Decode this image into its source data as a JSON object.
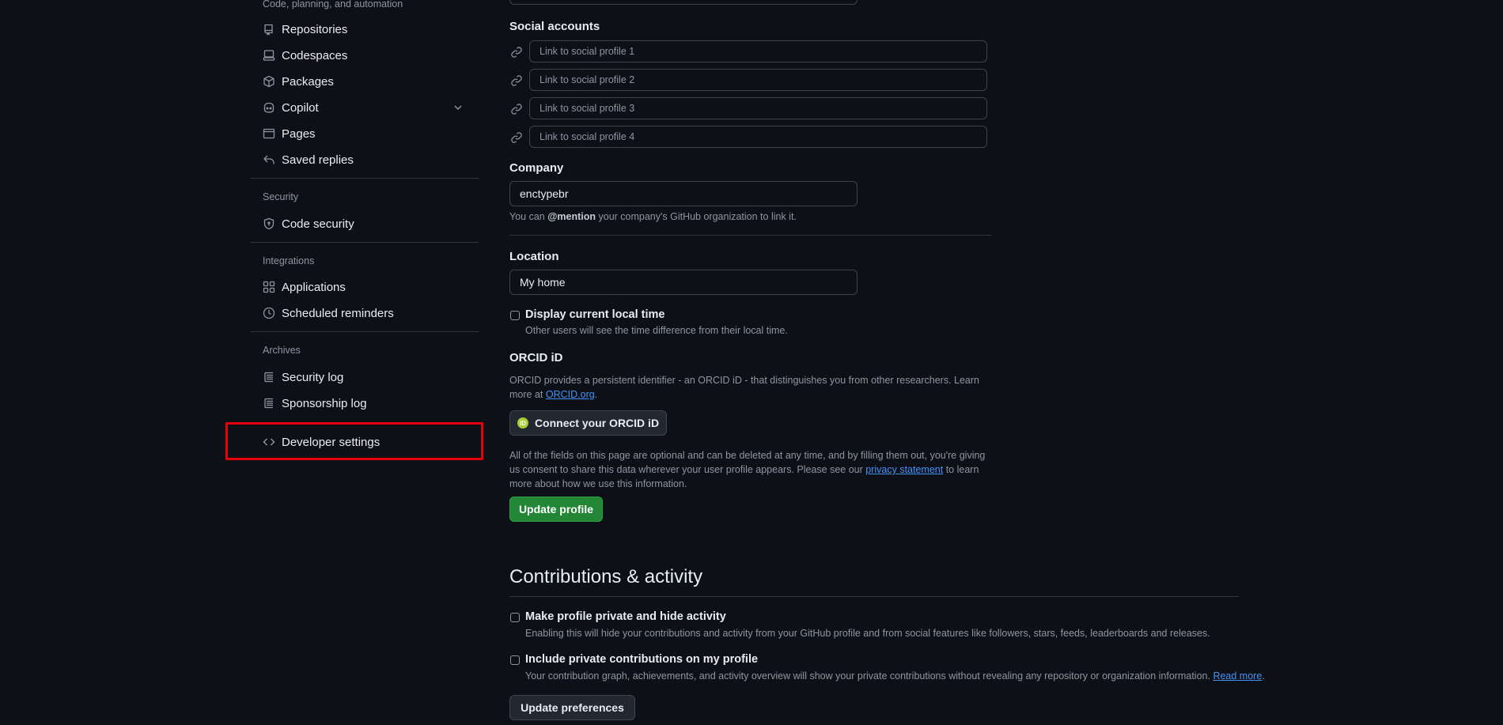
{
  "sidebar": {
    "group_code": "Code, planning, and automation",
    "items_code": [
      {
        "label": "Repositories",
        "icon": "repo-icon"
      },
      {
        "label": "Codespaces",
        "icon": "codespaces-icon"
      },
      {
        "label": "Packages",
        "icon": "package-icon"
      },
      {
        "label": "Copilot",
        "icon": "copilot-icon"
      },
      {
        "label": "Pages",
        "icon": "browser-icon"
      },
      {
        "label": "Saved replies",
        "icon": "reply-icon"
      }
    ],
    "group_security": "Security",
    "item_code_security": "Code security",
    "group_integrations": "Integrations",
    "item_applications": "Applications",
    "item_scheduled_reminders": "Scheduled reminders",
    "group_archives": "Archives",
    "item_security_log": "Security log",
    "item_sponsorship_log": "Sponsorship log",
    "item_developer_settings": "Developer settings"
  },
  "profile": {
    "social_heading": "Social accounts",
    "social_placeholders": [
      "Link to social profile 1",
      "Link to social profile 2",
      "Link to social profile 3",
      "Link to social profile 4"
    ],
    "company_heading": "Company",
    "company_value": "enctypebr",
    "company_note_prefix": "You can ",
    "company_note_mention": "@mention",
    "company_note_suffix": " your company's GitHub organization to link it.",
    "location_heading": "Location",
    "location_value": "My home",
    "local_time_label": "Display current local time",
    "local_time_note": "Other users will see the time difference from their local time.",
    "orcid_heading": "ORCID iD",
    "orcid_text": "ORCID provides a persistent identifier - an ORCID iD - that distinguishes you from other researchers. Learn more at",
    "orcid_link": "ORCID.org",
    "orcid_period": ".",
    "orcid_button": "Connect your ORCID iD",
    "orcid_badge": "iD",
    "privacy_text_1": "All of the fields on this page are optional and can be deleted at any time, and by filling them out, you're giving us consent to share this data wherever your user profile appears. Please see our ",
    "privacy_link": "privacy statement",
    "privacy_text_2": " to learn more about how we use this information.",
    "update_profile_button": "Update profile"
  },
  "contributions": {
    "heading": "Contributions & activity",
    "private_label": "Make profile private and hide activity",
    "private_note": "Enabling this will hide your contributions and activity from your GitHub profile and from social features like followers, stars, feeds, leaderboards and releases.",
    "include_label": "Include private contributions on my profile",
    "include_note": "Your contribution graph, achievements, and activity overview will show your private contributions without revealing any repository or organization information.",
    "include_link": "Read more",
    "include_period": ".",
    "update_button": "Update preferences"
  },
  "colors": {
    "background": "#0d1117",
    "primary_button": "#238636",
    "highlight_box": "#e5000b",
    "link": "#4493f8"
  }
}
